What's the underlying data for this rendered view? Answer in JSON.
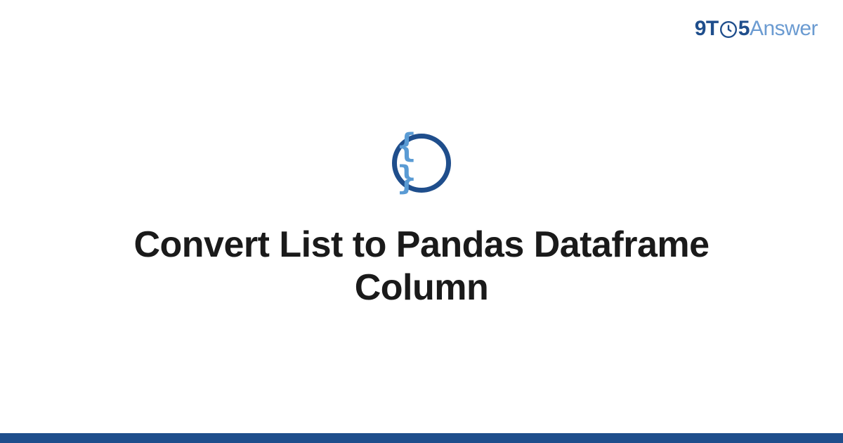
{
  "brand": {
    "segment_9t": "9T",
    "segment_5": "5",
    "segment_answer": "Answer"
  },
  "badge": {
    "glyph": "{ }"
  },
  "title": "Convert List to Pandas Dataframe Column",
  "colors": {
    "accent_dark": "#1f4e8c",
    "accent_light": "#5a9bd4"
  }
}
